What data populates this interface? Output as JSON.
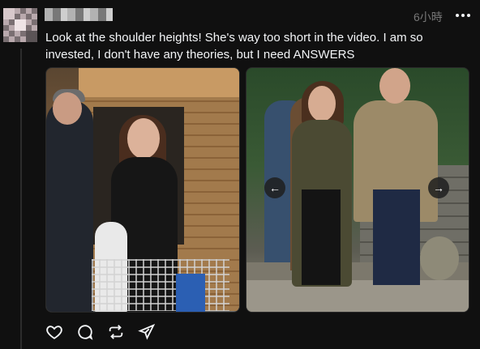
{
  "post": {
    "time": "6小時",
    "text": "Look at the shoulder heights! She's way too short in the video. I am so invested, I don't have any theories, but I need ANSWERS"
  },
  "media": {
    "prev_icon": "arrow-left",
    "next_icon": "arrow-right",
    "prev_glyph": "←",
    "next_glyph": "→"
  },
  "actions": {
    "items": [
      {
        "icon": "heart-icon"
      },
      {
        "icon": "comment-icon"
      },
      {
        "icon": "repost-icon"
      },
      {
        "icon": "share-icon"
      }
    ]
  },
  "colors": {
    "background": "#101010",
    "text": "#f3f5f7",
    "muted": "#777777"
  }
}
